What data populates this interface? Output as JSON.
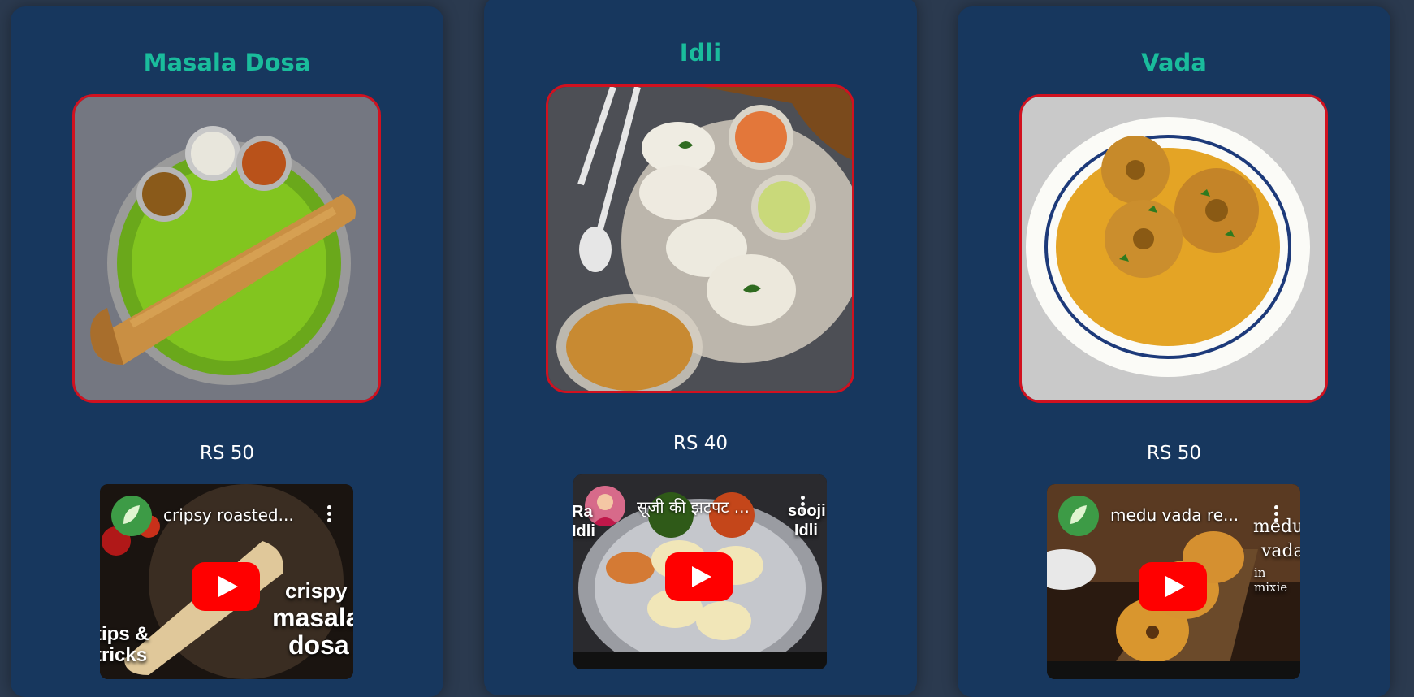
{
  "cards": [
    {
      "name": "Masala Dosa",
      "price": "RS 50",
      "video": {
        "title": "cripsy roasted...",
        "overlay_left": "tips &\ntricks",
        "overlay_right_1": "crispy",
        "overlay_right_2": "masala",
        "overlay_right_3": "dosa"
      }
    },
    {
      "name": "Idli",
      "price": "RS 40",
      "video": {
        "title": "सूजी की झटपट ...",
        "overlay_left": "Ra\nIdli",
        "overlay_right_1": "sooji",
        "overlay_right_2": "Idli"
      }
    },
    {
      "name": "Vada",
      "price": "RS 50",
      "video": {
        "title": "medu vada re...",
        "overlay_right_1": "medu",
        "overlay_right_2": "vada",
        "overlay_right_3": "in mixie"
      }
    }
  ],
  "colors": {
    "page_bg": "#2b3a4f",
    "card_bg": "#17375e",
    "title": "#1abc9c",
    "photo_border": "#d1111f",
    "play_button": "#ff0000"
  }
}
